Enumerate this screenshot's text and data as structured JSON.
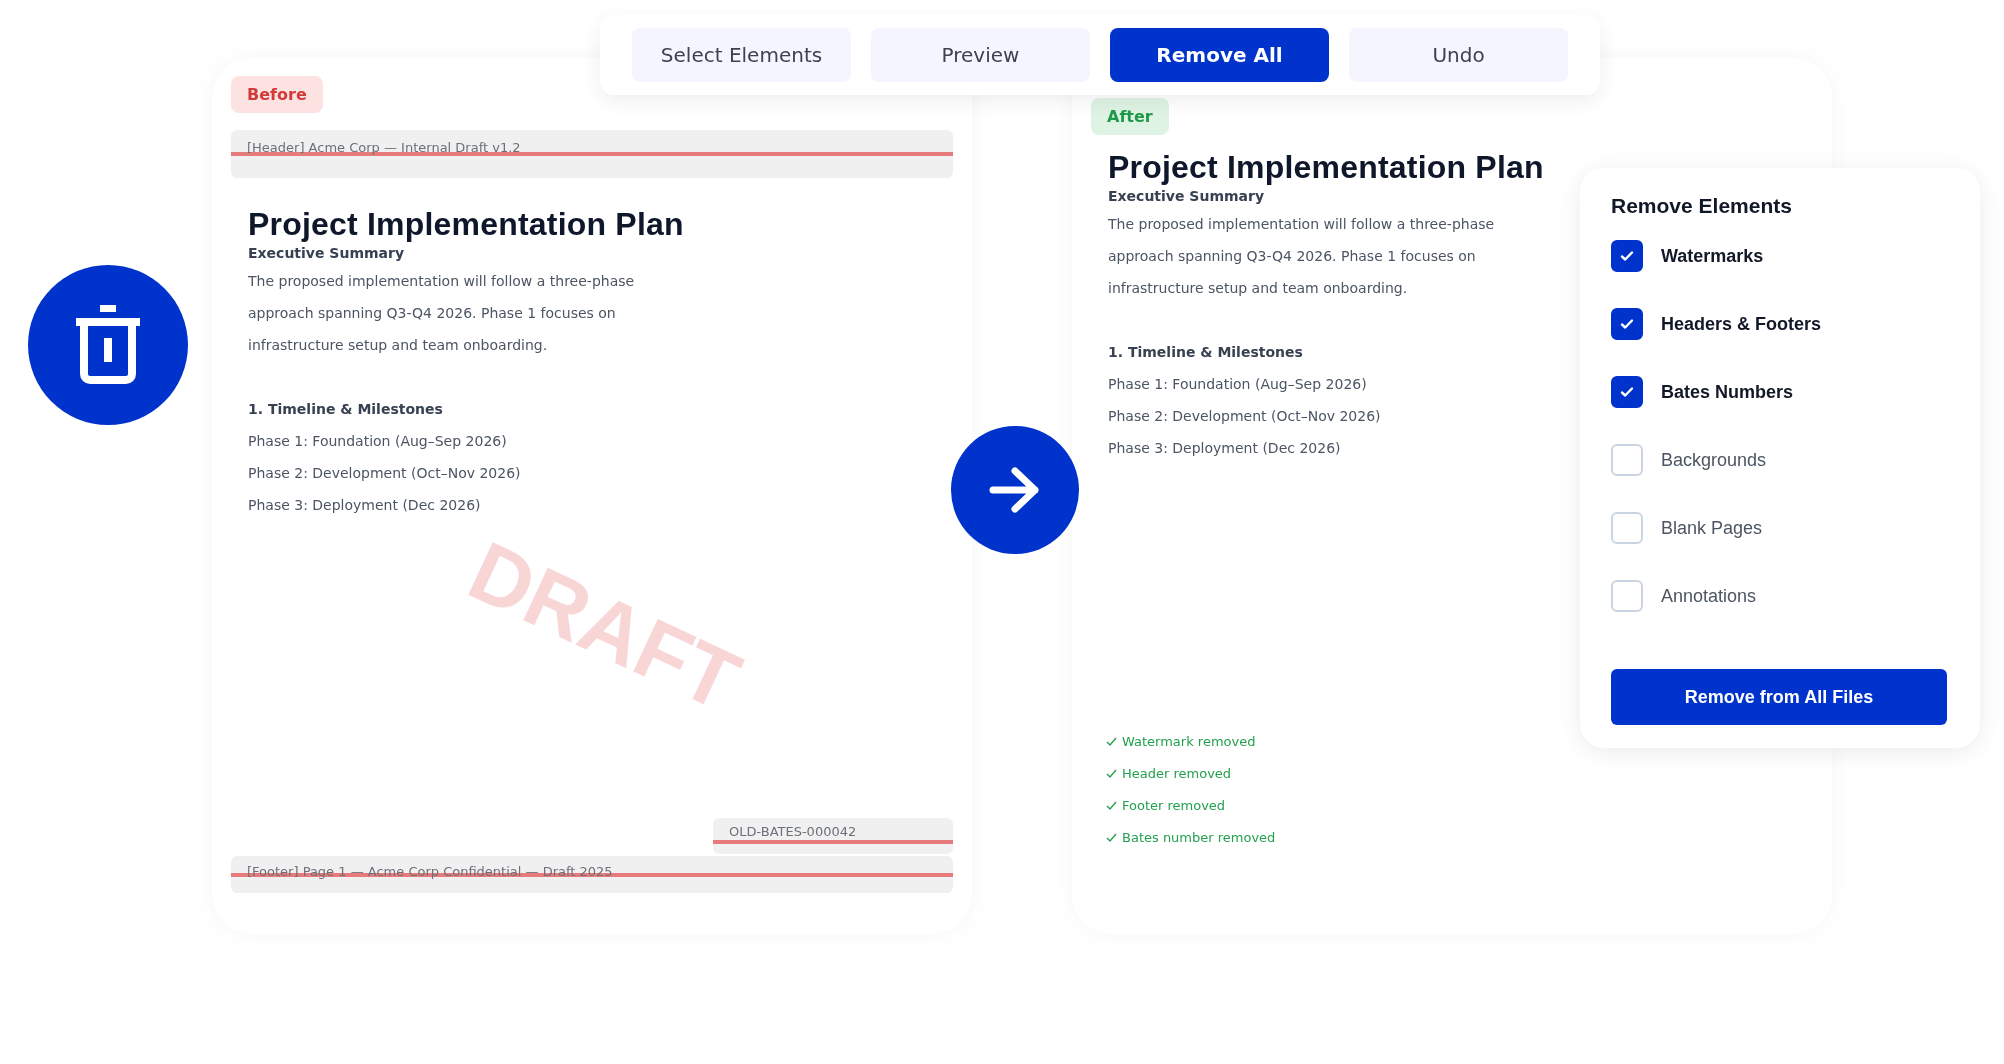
{
  "toolbar": {
    "buttons": [
      {
        "label": "Select Elements",
        "selected": false
      },
      {
        "label": "Preview",
        "selected": false
      },
      {
        "label": "Remove All",
        "selected": true
      },
      {
        "label": "Undo",
        "selected": false
      }
    ]
  },
  "before": {
    "badge": "Before",
    "header": "[Header] Acme Corp — Internal Draft v1.2",
    "title": "Project Implementation Plan",
    "subtitle": "Executive Summary",
    "paragraph": [
      "The proposed implementation will follow a three-phase",
      "approach spanning Q3-Q4 2026. Phase 1 focuses on",
      "infrastructure setup and team onboarding."
    ],
    "section": "1. Timeline & Milestones",
    "phases": [
      "Phase 1: Foundation (Aug–Sep 2026)",
      "Phase 2: Development (Oct–Nov 2026)",
      "Phase 3: Deployment (Dec 2026)"
    ],
    "watermark": "DRAFT",
    "bates": "OLD-BATES-000042",
    "footer": "[Footer] Page 1 — Acme Corp Confidential — Draft 2025"
  },
  "after": {
    "badge": "After",
    "title": "Project Implementation Plan",
    "subtitle": "Executive Summary",
    "paragraph": [
      "The proposed implementation will follow a three-phase",
      "approach spanning Q3-Q4 2026. Phase 1 focuses on",
      "infrastructure setup and team onboarding."
    ],
    "section": "1. Timeline & Milestones",
    "phases": [
      "Phase 1: Foundation (Aug–Sep 2026)",
      "Phase 2: Development (Oct–Nov 2026)",
      "Phase 3: Deployment (Dec 2026)"
    ],
    "status": [
      "Watermark removed",
      "Header removed",
      "Footer removed",
      "Bates number removed"
    ]
  },
  "panel": {
    "title": "Remove Elements",
    "options": [
      {
        "label": "Watermarks",
        "checked": true
      },
      {
        "label": "Headers & Footers",
        "checked": true
      },
      {
        "label": "Bates Numbers",
        "checked": true
      },
      {
        "label": "Backgrounds",
        "checked": false
      },
      {
        "label": "Blank Pages",
        "checked": false
      },
      {
        "label": "Annotations",
        "checked": false
      }
    ],
    "button": "Remove from All Files"
  }
}
